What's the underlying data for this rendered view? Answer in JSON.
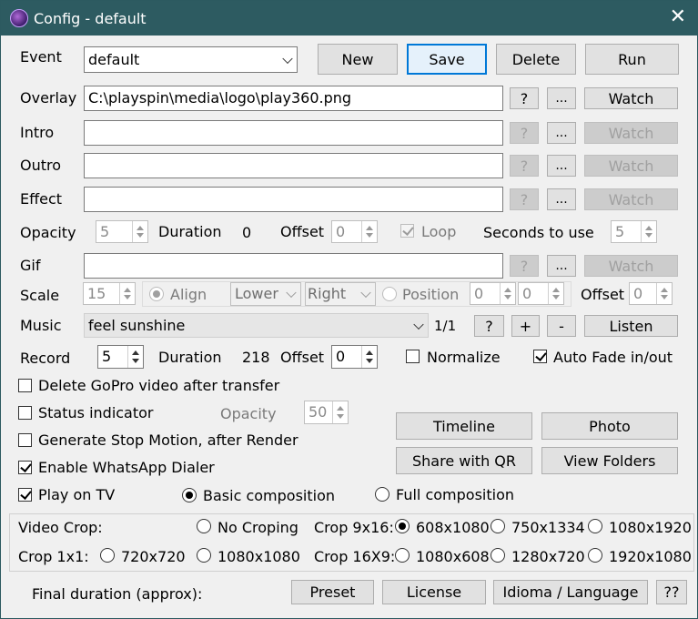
{
  "window": {
    "title": "Config - default",
    "close_glyph": "✕"
  },
  "event": {
    "label": "Event",
    "value": "default"
  },
  "buttons": {
    "new": "New",
    "save": "Save",
    "delete": "Delete",
    "run": "Run"
  },
  "overlay": {
    "label": "Overlay",
    "value": "C:\\playspin\\media\\logo\\play360.png",
    "help": "?",
    "browse": "...",
    "watch": "Watch"
  },
  "intro": {
    "label": "Intro",
    "value": "",
    "help": "?",
    "browse": "...",
    "watch": "Watch"
  },
  "outro": {
    "label": "Outro",
    "value": "",
    "help": "?",
    "browse": "...",
    "watch": "Watch"
  },
  "effect": {
    "label": "Effect",
    "value": "",
    "help": "?",
    "browse": "...",
    "watch": "Watch"
  },
  "opacity_row": {
    "label": "Opacity",
    "opacity": "5",
    "duration_label": "Duration",
    "duration": "0",
    "offset_label": "Offset",
    "offset": "0",
    "loop_label": "Loop",
    "seconds_label": "Seconds to use",
    "seconds": "5"
  },
  "gif": {
    "label": "Gif",
    "value": "",
    "help": "?",
    "browse": "...",
    "watch": "Watch"
  },
  "scale_row": {
    "label": "Scale",
    "scale": "15",
    "align_label": "Align",
    "align_v": "Lower",
    "align_h": "Right",
    "position_label": "Position",
    "pos_x": "0",
    "pos_y": "0",
    "offset_label": "Offset",
    "offset": "0"
  },
  "music": {
    "label": "Music",
    "value": "feel sunshine",
    "count": "1/1",
    "help": "?",
    "add": "+",
    "remove": "-",
    "listen": "Listen"
  },
  "record_row": {
    "label": "Record",
    "record": "5",
    "duration_label": "Duration",
    "duration": "218",
    "offset_label": "Offset",
    "offset": "0",
    "normalize_label": "Normalize",
    "autofade_label": "Auto Fade in/out"
  },
  "options": {
    "delete_gopro": "Delete GoPro video after transfer",
    "status_indicator": "Status indicator",
    "status_opacity_label": "Opacity",
    "status_opacity": "50",
    "stop_motion": "Generate Stop Motion, after Render",
    "whatsapp": "Enable WhatsApp Dialer",
    "play_tv": "Play on TV",
    "basic_comp": "Basic composition",
    "full_comp": "Full composition"
  },
  "side_buttons": {
    "timeline": "Timeline",
    "photo": "Photo",
    "share_qr": "Share with QR",
    "view_folders": "View Folders"
  },
  "crop": {
    "video_crop_label": "Video Crop:",
    "no_cropping": "No Croping",
    "crop9x16_label": "Crop 9x16:",
    "r608": "608x1080",
    "r750": "750x1334",
    "r1080x1920": "1080x1920",
    "crop1x1_label": "Crop 1x1:",
    "r720": "720x720",
    "r1080sq": "1080x1080",
    "crop16x9_label": "Crop 16X9:",
    "r1080x608": "1080x608",
    "r1280": "1280x720",
    "r1920": "1920x1080"
  },
  "footer": {
    "final_duration": "Final duration (approx):",
    "preset": "Preset",
    "license": "License",
    "language": "Idioma / Language",
    "help": "??"
  }
}
